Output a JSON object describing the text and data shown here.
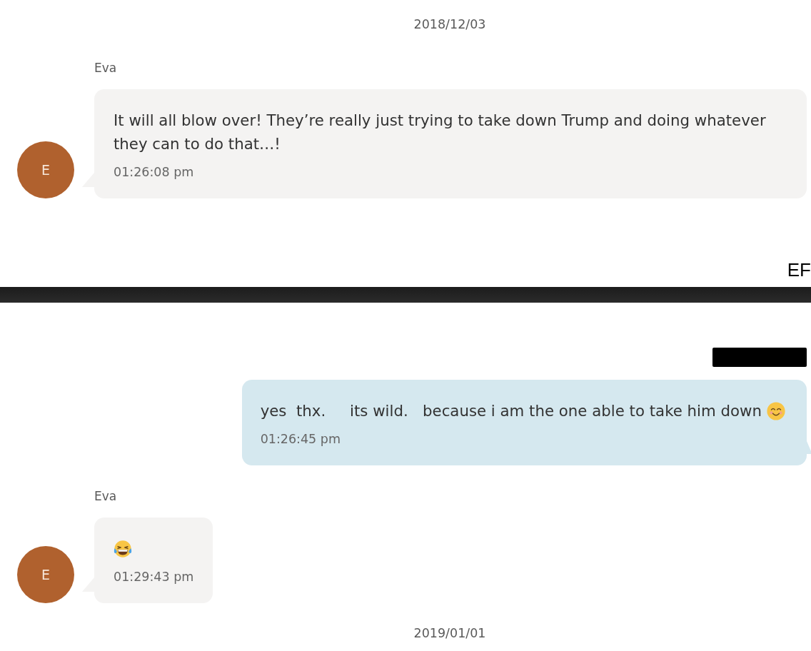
{
  "panels": [
    {
      "items": [
        {
          "kind": "date",
          "text": "2018/12/03"
        },
        {
          "kind": "incoming",
          "sender": "Eva",
          "avatar": "E",
          "content": [
            {
              "kind": "text",
              "text": "It will all blow over! They’re really just trying to take down Trump and doing whatever they can to do that…!"
            }
          ],
          "time": "01:26:08 pm"
        }
      ],
      "edge_text": "EF"
    },
    {
      "items": [
        {
          "kind": "redaction"
        },
        {
          "kind": "outgoing",
          "content": [
            {
              "kind": "text",
              "text": "yes  thx.     its wild.   because i am the one able to take him down"
            },
            {
              "kind": "smiling_emoji"
            }
          ],
          "time": "01:26:45 pm"
        },
        {
          "kind": "incoming",
          "sender": "Eva",
          "avatar": "E",
          "content": [
            {
              "kind": "laughing_emoji"
            }
          ],
          "time": "01:29:43 pm"
        },
        {
          "kind": "date",
          "text": "2019/01/01"
        }
      ]
    }
  ]
}
